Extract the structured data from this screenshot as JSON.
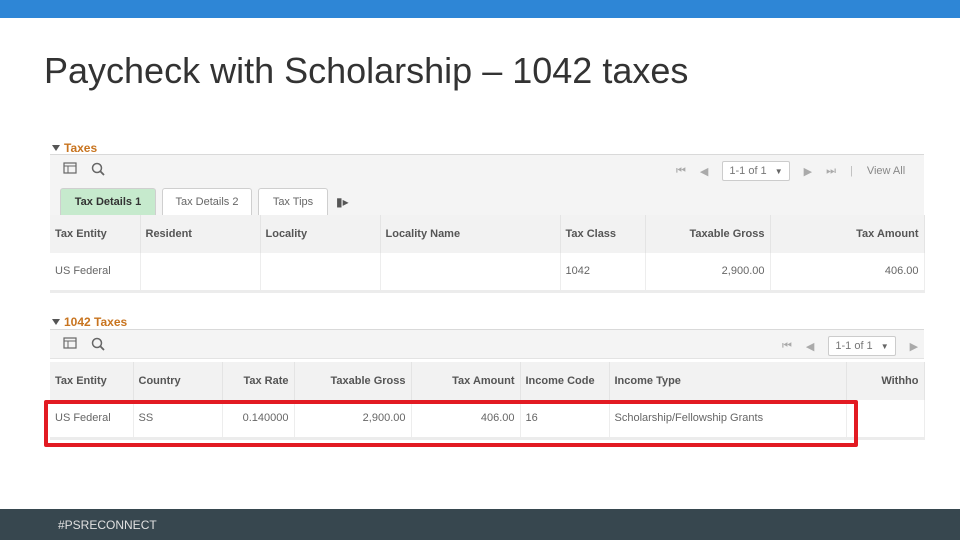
{
  "slide": {
    "title": "Paycheck with Scholarship – 1042 taxes",
    "footer": "#PSRECONNECT"
  },
  "colors": {
    "topbar": "#2e86d6",
    "footer_bar": "#37474f",
    "section_heading": "#c8741f",
    "active_tab": "#c6eacd",
    "highlight_border": "#e21a22"
  },
  "taxes": {
    "heading": "Taxes",
    "toolbar": {
      "grid_icon": "grid-icon",
      "search_icon": "search-icon",
      "first": "⏮",
      "prev": "◀",
      "range": "1-1 of 1",
      "next": "▶",
      "last": "⏭",
      "view_all": "View All"
    },
    "tabs": [
      {
        "label": "Tax Details 1",
        "active": true
      },
      {
        "label": "Tax Details 2",
        "active": false
      },
      {
        "label": "Tax Tips",
        "active": false
      }
    ],
    "tab_more": "▮▸",
    "columns": [
      "Tax Entity",
      "Resident",
      "Locality",
      "Locality Name",
      "Tax Class",
      "Taxable Gross",
      "Tax Amount"
    ],
    "rows": [
      [
        "US Federal",
        "",
        "",
        "",
        "1042",
        "2,900.00",
        "406.00"
      ]
    ]
  },
  "taxes_1042": {
    "heading": "1042 Taxes",
    "toolbar": {
      "grid_icon": "grid-icon",
      "search_icon": "search-icon",
      "first": "⏮",
      "prev": "◀",
      "range": "1-1 of 1",
      "next": "▶"
    },
    "columns": [
      "Tax Entity",
      "Country",
      "Tax Rate",
      "Taxable Gross",
      "Tax Amount",
      "Income Code",
      "Income Type",
      "Withho"
    ],
    "rows": [
      [
        "US Federal",
        "SS",
        "0.140000",
        "2,900.00",
        "406.00",
        "16",
        "Scholarship/Fellowship Grants",
        ""
      ]
    ]
  }
}
